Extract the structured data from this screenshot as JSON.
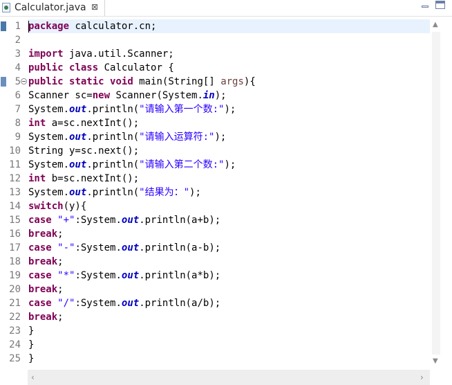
{
  "tab": {
    "title": "Calculator.java",
    "close_glyph": "⊠"
  },
  "editor": {
    "line_numbers": [
      "1",
      "2",
      "3",
      "4",
      "5",
      "6",
      "7",
      "8",
      "9",
      "10",
      "11",
      "12",
      "13",
      "14",
      "15",
      "16",
      "17",
      "18",
      "19",
      "20",
      "21",
      "22",
      "23",
      "24",
      "25"
    ],
    "lines": [
      [
        [
          "kw",
          "package"
        ],
        [
          "t",
          " calculator.cn;"
        ]
      ],
      [],
      [
        [
          "kw",
          "import"
        ],
        [
          "t",
          " java.util.Scanner;"
        ]
      ],
      [
        [
          "kw",
          "public"
        ],
        [
          "t",
          " "
        ],
        [
          "kw",
          "class"
        ],
        [
          "t",
          " Calculator {"
        ]
      ],
      [
        [
          "kw",
          "public"
        ],
        [
          "t",
          " "
        ],
        [
          "kw",
          "static"
        ],
        [
          "t",
          " "
        ],
        [
          "kw",
          "void"
        ],
        [
          "t",
          " main(String[] "
        ],
        [
          "param",
          "args"
        ],
        [
          "t",
          "){"
        ]
      ],
      [
        [
          "t",
          "Scanner sc="
        ],
        [
          "kw",
          "new"
        ],
        [
          "t",
          " Scanner(System."
        ],
        [
          "fld",
          "in"
        ],
        [
          "t",
          ");"
        ]
      ],
      [
        [
          "t",
          "System."
        ],
        [
          "fld",
          "out"
        ],
        [
          "t",
          ".println("
        ],
        [
          "str",
          "\"请输入第一个数:\""
        ],
        [
          "t",
          ");"
        ]
      ],
      [
        [
          "kw",
          "int"
        ],
        [
          "t",
          " a=sc.nextInt();"
        ]
      ],
      [
        [
          "t",
          "System."
        ],
        [
          "fld",
          "out"
        ],
        [
          "t",
          ".println("
        ],
        [
          "str",
          "\"请输入运算符:\""
        ],
        [
          "t",
          ");"
        ]
      ],
      [
        [
          "t",
          "String y=sc.next();"
        ]
      ],
      [
        [
          "t",
          "System."
        ],
        [
          "fld",
          "out"
        ],
        [
          "t",
          ".println("
        ],
        [
          "str",
          "\"请输入第二个数:\""
        ],
        [
          "t",
          ");"
        ]
      ],
      [
        [
          "kw",
          "int"
        ],
        [
          "t",
          " b=sc.nextInt();"
        ]
      ],
      [
        [
          "t",
          "System."
        ],
        [
          "fld",
          "out"
        ],
        [
          "t",
          ".println("
        ],
        [
          "str",
          "\"结果为：\""
        ],
        [
          "t",
          ");"
        ]
      ],
      [
        [
          "kw",
          "switch"
        ],
        [
          "t",
          "(y){"
        ]
      ],
      [
        [
          "kw",
          "case"
        ],
        [
          "t",
          " "
        ],
        [
          "str",
          "\"+\""
        ],
        [
          "t",
          ":System."
        ],
        [
          "fld",
          "out"
        ],
        [
          "t",
          ".println(a+b);"
        ]
      ],
      [
        [
          "kw",
          "break"
        ],
        [
          "t",
          ";"
        ]
      ],
      [
        [
          "kw",
          "case"
        ],
        [
          "t",
          " "
        ],
        [
          "str",
          "\"-\""
        ],
        [
          "t",
          ":System."
        ],
        [
          "fld",
          "out"
        ],
        [
          "t",
          ".println(a-b);"
        ]
      ],
      [
        [
          "kw",
          "break"
        ],
        [
          "t",
          ";"
        ]
      ],
      [
        [
          "kw",
          "case"
        ],
        [
          "t",
          " "
        ],
        [
          "str",
          "\"*\""
        ],
        [
          "t",
          ":System."
        ],
        [
          "fld",
          "out"
        ],
        [
          "t",
          ".println(a*b);"
        ]
      ],
      [
        [
          "kw",
          "break"
        ],
        [
          "t",
          ";"
        ]
      ],
      [
        [
          "kw",
          "case"
        ],
        [
          "t",
          " "
        ],
        [
          "str",
          "\"/\""
        ],
        [
          "t",
          ":System."
        ],
        [
          "fld",
          "out"
        ],
        [
          "t",
          ".println(a/b);"
        ]
      ],
      [
        [
          "kw",
          "break"
        ],
        [
          "t",
          ";"
        ]
      ],
      [
        [
          "t",
          "}"
        ]
      ],
      [
        [
          "t",
          "}"
        ]
      ],
      [
        [
          "t",
          "}"
        ]
      ]
    ],
    "fold_lines": [
      5
    ]
  },
  "colors": {
    "keyword": "#7f0055",
    "string": "#2a00ff",
    "field": "#0000c0",
    "current_line": "#e8f2fe"
  },
  "icons": {
    "file": "java-file-icon",
    "close": "close-icon",
    "minimize": "minimize-icon",
    "maximize": "maximize-icon"
  }
}
